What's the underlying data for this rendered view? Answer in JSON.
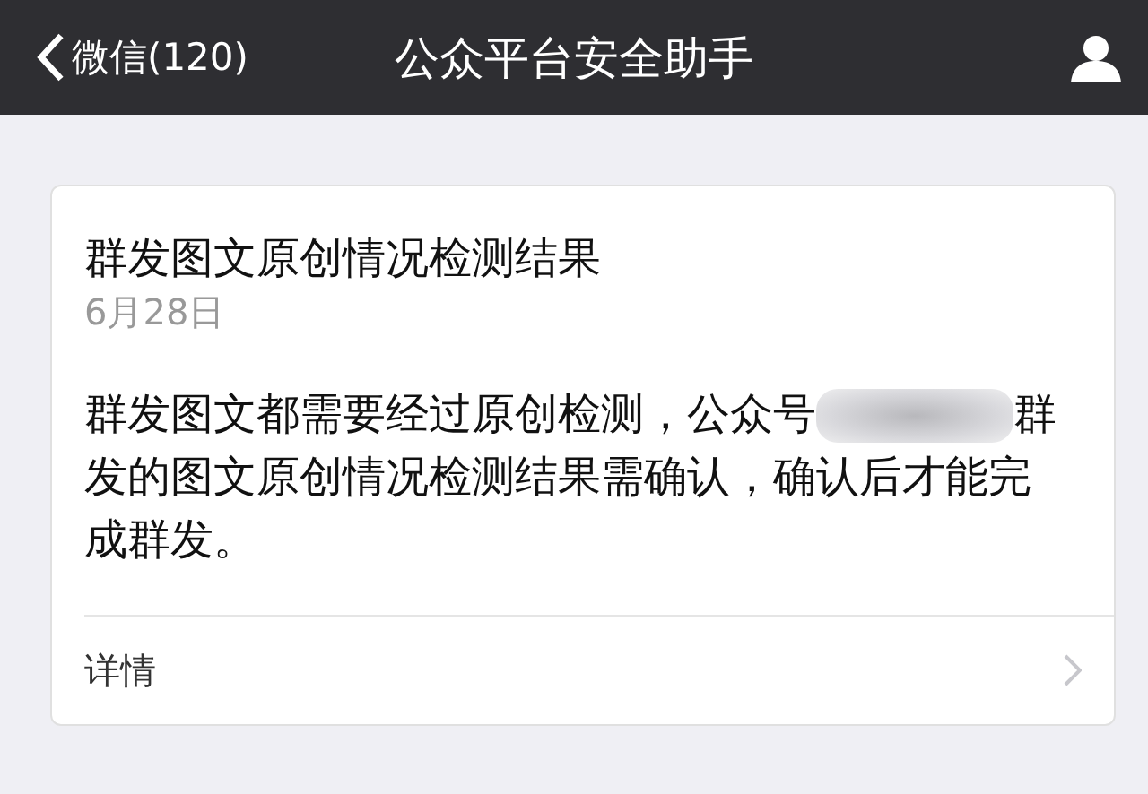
{
  "nav_bar": {
    "back_label": "微信(120)",
    "title": "公众平台安全助手"
  },
  "message_card": {
    "title": "群发图文原创情况检测结果",
    "date": "6月28日",
    "body_before": "群发图文都需要经过原创检测，公众号",
    "account_name_redacted": true,
    "body_after": "群发的图文原创情况检测结果需确认，确认后才能完成群发。",
    "details_link": "详情"
  }
}
